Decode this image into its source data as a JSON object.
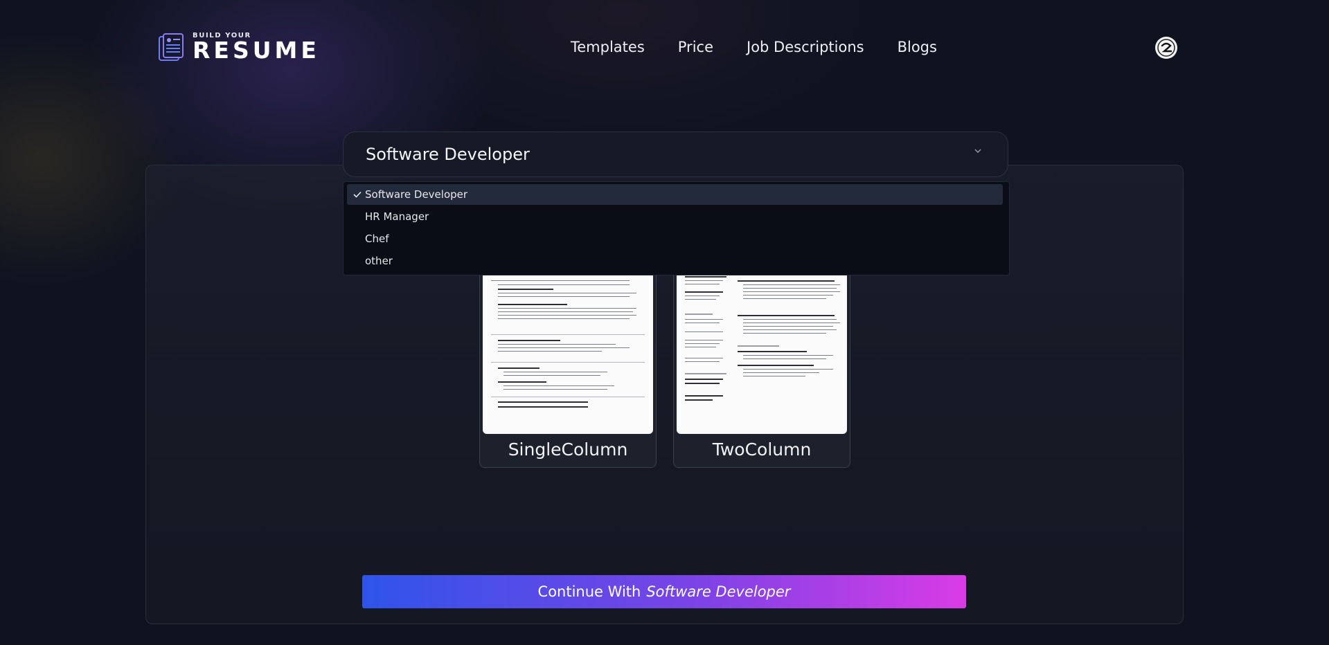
{
  "header": {
    "logo_small": "BUILD YOUR",
    "logo_big": "RESUME",
    "nav": [
      "Templates",
      "Price",
      "Job Descriptions",
      "Blogs"
    ]
  },
  "job_select": {
    "value": "Software Developer",
    "options": [
      {
        "label": "Software Developer",
        "selected": true
      },
      {
        "label": "HR Manager",
        "selected": false
      },
      {
        "label": "Chef",
        "selected": false
      },
      {
        "label": "other",
        "selected": false
      }
    ]
  },
  "templates": [
    {
      "name": "SingleColumn"
    },
    {
      "name": "TwoColumn"
    }
  ],
  "continue_button": {
    "prefix": "Continue With",
    "job": "Software Developer"
  },
  "colors": {
    "accent_start": "#2f54ea",
    "accent_end": "#d93be6",
    "background": "#0f1320"
  },
  "icons": [
    "resume-logo-icon",
    "user-avatar-icon",
    "chevron-down-icon",
    "check-icon"
  ]
}
